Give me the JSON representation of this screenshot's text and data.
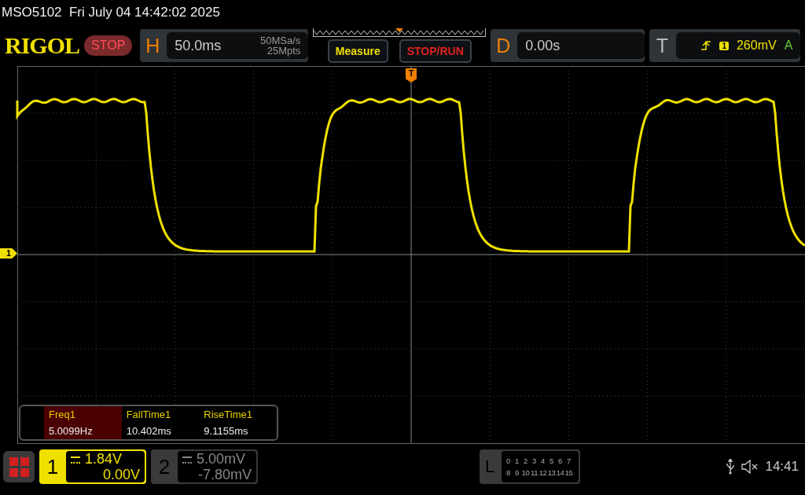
{
  "title": "MSO5102  Fri July 04 14:42:02 2025",
  "brand": "RIGOL",
  "run_state": "STOP",
  "horizontal": {
    "label": "H",
    "scale": "50.0ms",
    "sample_rate": "50MSa/s",
    "memory_depth": "25Mpts"
  },
  "buttons": [
    {
      "label": "Measure",
      "kind": "measure"
    },
    {
      "label": "STOP/RUN",
      "kind": "run"
    }
  ],
  "delay": {
    "label": "D",
    "value": "0.00s"
  },
  "trigger": {
    "label": "T",
    "source": "1",
    "level": "260mV",
    "mode": "A"
  },
  "markers": {
    "trigger": "T",
    "channel": "1"
  },
  "measurements": [
    {
      "name": "Freq1",
      "value": "5.0099Hz",
      "selected": true
    },
    {
      "name": "FallTime1",
      "value": "10.402ms",
      "selected": false
    },
    {
      "name": "RiseTime1",
      "value": "9.1155ms",
      "selected": false
    }
  ],
  "channels": [
    {
      "label": "1",
      "scale": "1.84V",
      "offset": "0.00V",
      "active": true
    },
    {
      "label": "2",
      "scale": "5.00mV",
      "offset": "-7.80mV",
      "active": false
    }
  ],
  "logic": {
    "label": "L",
    "rows": [
      [
        "0",
        "1",
        "2",
        "3",
        "4",
        "5",
        "6",
        "7"
      ],
      [
        "8",
        "9",
        "10",
        "11",
        "12",
        "13",
        "14",
        "15"
      ]
    ]
  },
  "clock": "14:41"
}
